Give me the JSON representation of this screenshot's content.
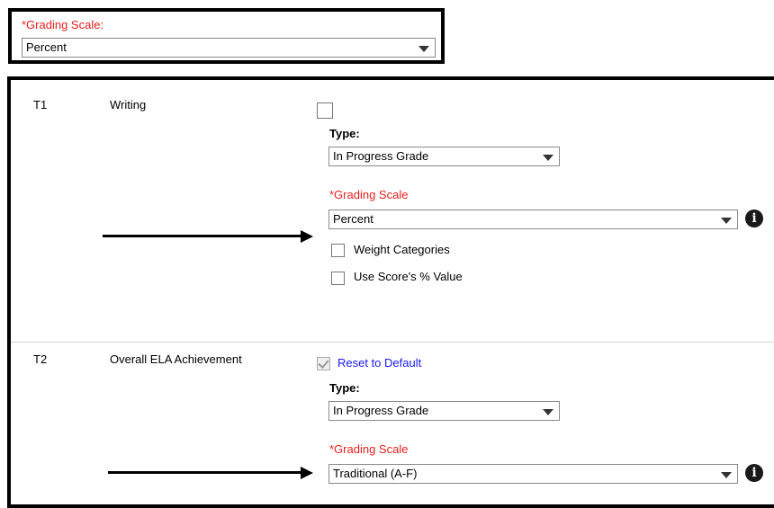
{
  "top": {
    "grading_scale_label": "*Grading Scale:",
    "grading_scale_value": "Percent"
  },
  "rows": [
    {
      "code": "T1",
      "name": "Writing",
      "type_label": "Type:",
      "type_value": "In Progress Grade",
      "grading_scale_label": "*Grading Scale",
      "grading_scale_value": "Percent",
      "options": [
        "Weight Categories",
        "Use Score's % Value"
      ]
    },
    {
      "code": "T2",
      "name": "Overall ELA Achievement",
      "reset_label": "Reset to Default",
      "type_label": "Type:",
      "type_value": "In Progress Grade",
      "grading_scale_label": "*Grading Scale",
      "grading_scale_value": "Traditional (A-F)"
    }
  ],
  "info_icon_glyph": "i",
  "colors": {
    "required": "#e8201f",
    "link": "#1a1aee"
  }
}
